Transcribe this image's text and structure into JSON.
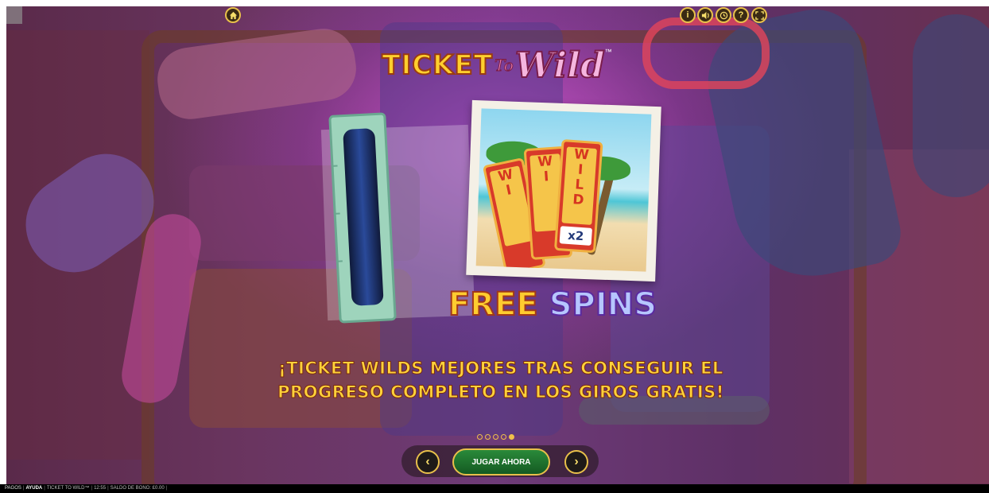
{
  "header": {
    "home_icon": "home-icon",
    "icons": [
      "info-icon",
      "sound-icon",
      "history-icon",
      "help-icon",
      "fullscreen-icon"
    ]
  },
  "logo": {
    "ticket": "TICKET",
    "to": "To",
    "wild": "Wild",
    "tm": "™"
  },
  "feature": {
    "wild_card_letters": [
      "W",
      "I",
      "L",
      "D"
    ],
    "multiplier": "x2",
    "free": "FREE",
    "spins": "SPINS",
    "description": "¡TICKET WILDS MEJORES TRAS CONSEGUIR EL PROGRESO COMPLETO EN LOS GIROS GRATIS!"
  },
  "pagination": {
    "total": 5,
    "active": 5
  },
  "nav": {
    "prev_icon": "‹",
    "next_icon": "›",
    "play_label": "JUGAR AHORA"
  },
  "footer": {
    "pagos": "PAGOS",
    "ayuda": "AYUDA",
    "game": "TICKET TO WILD™",
    "time": "12:55",
    "balance": "SALDO DE BONO: £0.00"
  },
  "colors": {
    "accent_gold": "#e8c04a",
    "play_green": "#2a8a3a",
    "text_gold": "#ffd23a"
  }
}
